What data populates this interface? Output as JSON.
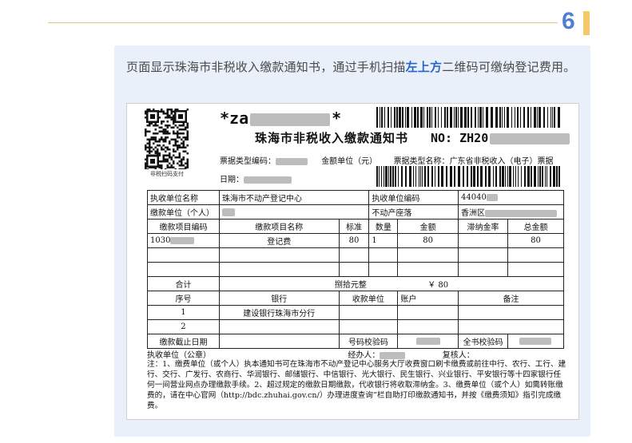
{
  "step": {
    "number": "6"
  },
  "description": {
    "before": "页面显示珠海市非税收入缴款通知书，通过手机扫描",
    "highlight": "左上方",
    "after": "二维码可缴纳登记费用。"
  },
  "document": {
    "qr_caption": "非税扫码支付",
    "code_prefix": "*za",
    "code_suffix": "*",
    "title": "珠海市非税收入缴款通知书",
    "no_label": "NO:",
    "no_value": "ZH20",
    "bill_type_code_label": "票据类型编码：",
    "amount_unit_label": "金额单位（元）",
    "bill_type_name_label": "票据类型名称：",
    "bill_type_name_value": "广东省非税收入（电子）票据",
    "date_label": "日期：",
    "table": {
      "collect_unit_label": "执收单位名称",
      "collect_unit_value": "珠海市不动产登记中心",
      "collect_code_label": "执收单位编码",
      "collect_code_value": "44040",
      "payer_label": "缴款单位（个人）",
      "location_label": "不动产座落",
      "location_value": "香洲区",
      "columns": [
        "缴款项目编码",
        "缴款项目名称",
        "标准",
        "数量",
        "金额",
        "滞纳金率",
        "总金额"
      ],
      "item_code": "1030",
      "item_name": "登记费",
      "item_standard": "80",
      "item_quantity": "1",
      "item_amount": "80",
      "item_total": "80",
      "total_label": "合计",
      "total_words": "捌拾元整",
      "total_amount": "￥ 80",
      "seq_label": "序号",
      "bank_label": "银行",
      "payee_label": "收款单位",
      "account_label": "账户",
      "remark_label": "备注",
      "row1_seq": "1",
      "row1_bank": "建设银行珠海市分行",
      "row2_seq": "2",
      "deadline_label": "缴款截止日期",
      "check_code_label": "号码校验码",
      "full_check_label": "全书校验码"
    },
    "footer": {
      "unit_seal": "执收单位（公章）",
      "handler": "经办人：",
      "reviewer": "复核人："
    },
    "notes": "注：1、缴费单位（或个人）执本通知书可在珠海市不动产登记中心服务大厅收费窗口刷卡缴费或前往中行、农行、工行、建行、交行、广发行、农商行、华润银行、邮储银行、中信银行、光大银行、民生银行、兴业银行、平安银行等十四家银行任何一间营业网点办理缴款手续。2、超过规定的缴款日期缴款，代收银行将收取滞纳金。3、缴费单位（或个人）如需转账缴费的，请在中心官网（http://bdc.zhuhai.gov.cn/）办理进度查询”栏自助打印缴款通知书，并按《缴费须知》指引完成缴费。"
  },
  "colors": {
    "accent": "#4f7fd0",
    "highlight": "#2a66c8",
    "tab_bar": "#f5c96a",
    "card_bg": "#e9f0fa"
  }
}
